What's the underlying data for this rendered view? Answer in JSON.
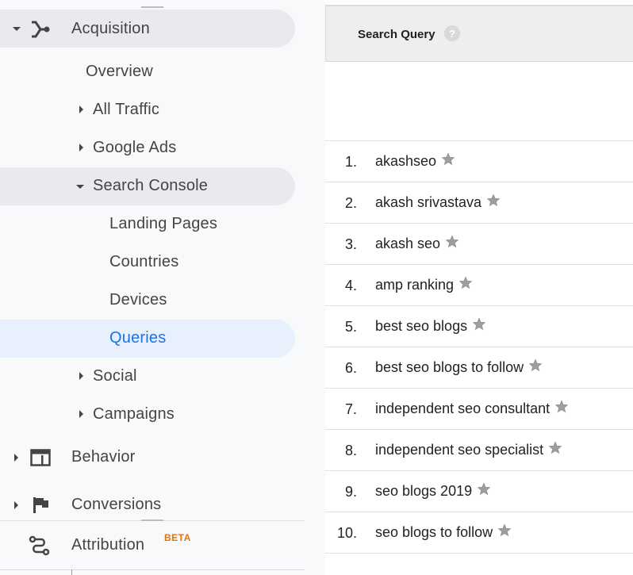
{
  "sidebar": {
    "acquisition": "Acquisition",
    "overview": "Overview",
    "all_traffic": "All Traffic",
    "google_ads": "Google Ads",
    "search_console": "Search Console",
    "landing_pages": "Landing Pages",
    "countries": "Countries",
    "devices": "Devices",
    "queries": "Queries",
    "social": "Social",
    "campaigns": "Campaigns",
    "behavior": "Behavior",
    "conversions": "Conversions",
    "attribution": "Attribution",
    "beta_badge": "BETA"
  },
  "icons": {
    "acquisition": "acquisition-fork-icon",
    "behavior": "behavior-window-icon",
    "conversions": "flag-icon",
    "attribution": "attribution-path-icon",
    "help": "help-question-icon",
    "star": "star-icon"
  },
  "colors": {
    "active_text": "#1a73e8",
    "active_pill": "#e8f0fe",
    "selected_group_pill": "#e8eaed",
    "beta": "#e8710a"
  },
  "table": {
    "header": "Search Query",
    "help_glyph": "?",
    "rows": [
      {
        "num": "1.",
        "query": "akashseo"
      },
      {
        "num": "2.",
        "query": "akash srivastava"
      },
      {
        "num": "3.",
        "query": "akash seo"
      },
      {
        "num": "4.",
        "query": "amp ranking"
      },
      {
        "num": "5.",
        "query": "best seo blogs"
      },
      {
        "num": "6.",
        "query": "best seo blogs to follow"
      },
      {
        "num": "7.",
        "query": "independent seo consultant"
      },
      {
        "num": "8.",
        "query": "independent seo specialist"
      },
      {
        "num": "9.",
        "query": "seo blogs 2019"
      },
      {
        "num": "10.",
        "query": "seo blogs to follow"
      }
    ]
  }
}
